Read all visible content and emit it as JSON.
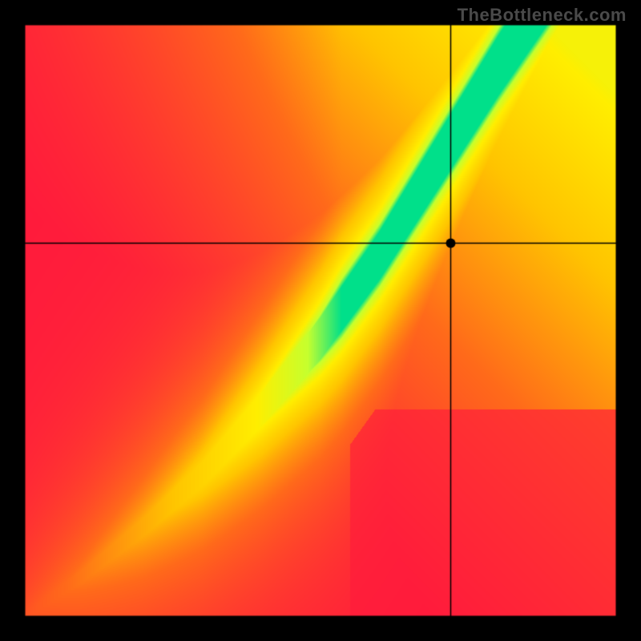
{
  "watermark": "TheBottleneck.com",
  "chart_data": {
    "type": "heatmap",
    "title": "",
    "xlabel": "",
    "ylabel": "",
    "xlim": [
      0,
      1
    ],
    "ylim": [
      0,
      1
    ],
    "crosshair": {
      "x": 0.72,
      "y": 0.63
    },
    "marker": {
      "x": 0.72,
      "y": 0.63
    },
    "green_band": {
      "description": "Narrow diagonal band where values are optimal (green). Band follows an S-curve from bottom-left to upper-center-right.",
      "control_points_x": [
        0.0,
        0.1,
        0.2,
        0.3,
        0.4,
        0.5,
        0.6,
        0.7,
        0.8,
        0.9,
        1.0
      ],
      "center_y": [
        0.0,
        0.07,
        0.15,
        0.24,
        0.35,
        0.47,
        0.61,
        0.77,
        0.93,
        1.08,
        1.22
      ],
      "half_width": [
        0.005,
        0.01,
        0.015,
        0.02,
        0.028,
        0.035,
        0.04,
        0.045,
        0.05,
        0.055,
        0.06
      ]
    },
    "gradient_corners": {
      "top_left": "red",
      "top_right": "yellow",
      "bottom_left": "red",
      "bottom_right": "red",
      "center_band": "green",
      "near_band": "yellow"
    },
    "color_stops": [
      {
        "t": 0.0,
        "color": "#ff1a3c"
      },
      {
        "t": 0.35,
        "color": "#ff6a1a"
      },
      {
        "t": 0.6,
        "color": "#ffc400"
      },
      {
        "t": 0.8,
        "color": "#ffee00"
      },
      {
        "t": 0.92,
        "color": "#c6ff2e"
      },
      {
        "t": 1.0,
        "color": "#00e08a"
      }
    ]
  }
}
